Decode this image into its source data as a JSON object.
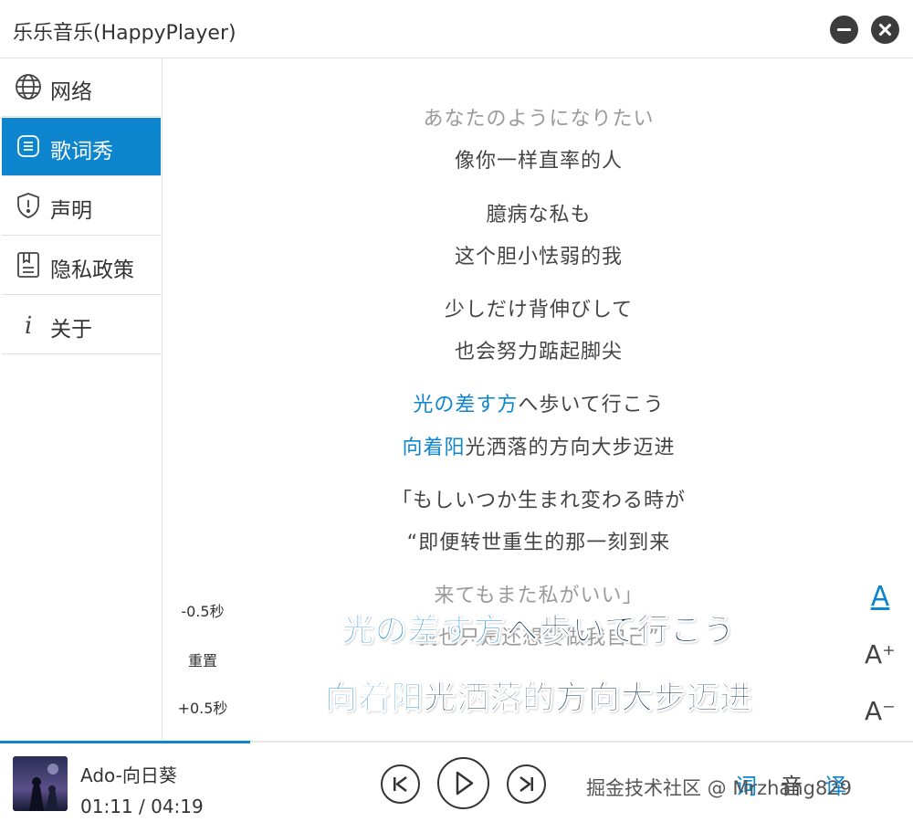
{
  "window": {
    "title": "乐乐音乐(HappyPlayer)"
  },
  "sidebar": {
    "items": [
      {
        "label": "网络",
        "icon": "globe-icon"
      },
      {
        "label": "歌词秀",
        "icon": "lyrics-icon",
        "active": true
      },
      {
        "label": "声明",
        "icon": "shield-icon"
      },
      {
        "label": "隐私政策",
        "icon": "policy-icon"
      },
      {
        "label": "关于",
        "icon": "info-icon"
      }
    ]
  },
  "lyrics": {
    "lines": [
      {
        "text": "あなたのようになりたい"
      },
      {
        "text": "像你一样直率的人"
      },
      {
        "text": "臆病な私も"
      },
      {
        "text": "这个胆小怯弱的我"
      },
      {
        "text": "少しだけ背伸びして"
      },
      {
        "text": "也会努力踮起脚尖"
      },
      {
        "hl": "光の差す方",
        "rest": "へ歩いて行こう"
      },
      {
        "hl": "向着阳",
        "rest": "光洒落的方向大步迈进"
      },
      {
        "text": "「もしいつか生まれ変わる時が"
      },
      {
        "text": "“即便转世重生的那一刻到来"
      },
      {
        "text": "来てもまた私がいい」"
      },
      {
        "text": "我也只是还想要做我自己”"
      }
    ],
    "offset_controls": {
      "minus": "-0.5秒",
      "reset": "重置",
      "plus": "+0.5秒"
    },
    "font_controls": {
      "color": "A",
      "increase": "A⁺",
      "decrease": "A⁻"
    }
  },
  "desktop_lyrics": {
    "line1": {
      "done": "光の差す方",
      "rest": "へ歩いて行こう"
    },
    "line2": {
      "done": "向着阳",
      "rest": "光洒落的方向大步迈进"
    }
  },
  "player": {
    "song_title": "Ado-向日葵",
    "time": "01:11 / 04:19",
    "progress": 0.274,
    "modes": {
      "lyric": "词",
      "sound": "音",
      "translate": "译"
    },
    "watermark": "掘金技术社区 @ Mrzhang829"
  },
  "colors": {
    "accent": "#0e85cf",
    "overlay_done": "#1c8fe0",
    "overlay_rest": "#0b2f52"
  }
}
